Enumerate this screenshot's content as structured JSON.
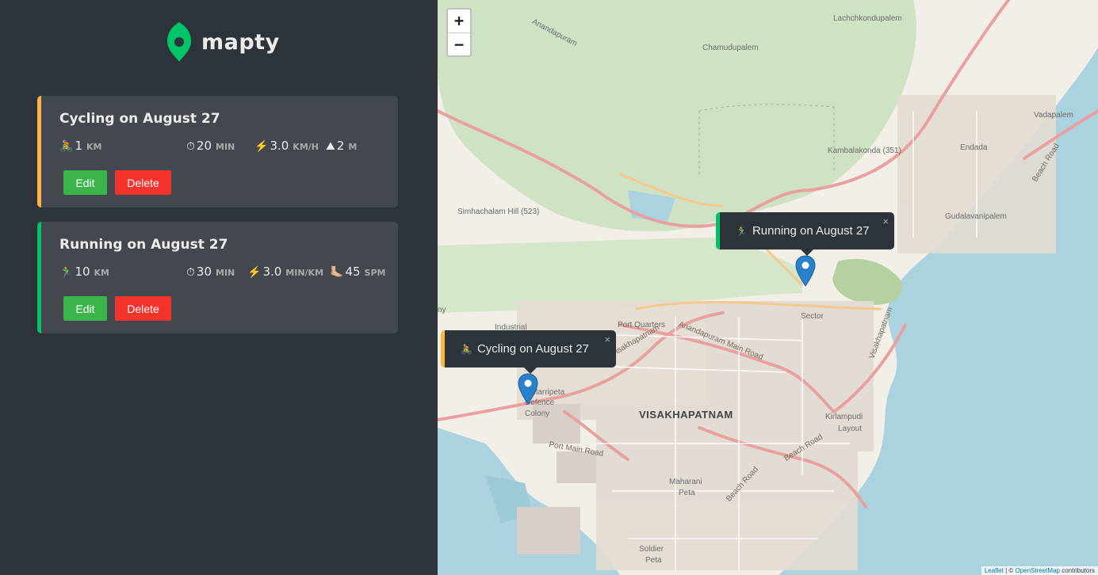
{
  "logo": {
    "text": "mapty",
    "icon": "map-pin-icon",
    "color": "#00c46a"
  },
  "workouts": [
    {
      "type": "cycling",
      "accent": "#ffb545",
      "title": "Cycling on August 27",
      "distance": {
        "icon": "🚴",
        "value": "1",
        "unit": "km"
      },
      "duration": {
        "icon": "⏱",
        "value": "20",
        "unit": "min"
      },
      "speed": {
        "icon": "⚡️",
        "value": "3.0",
        "unit": "km/h"
      },
      "extra": {
        "icon": "⛰",
        "value": "2",
        "unit": "m"
      },
      "edit_label": "Edit",
      "delete_label": "Delete"
    },
    {
      "type": "running",
      "accent": "#00c46a",
      "title": "Running on August 27",
      "distance": {
        "icon": "🏃‍♂️",
        "value": "10",
        "unit": "km"
      },
      "duration": {
        "icon": "⏱",
        "value": "30",
        "unit": "min"
      },
      "speed": {
        "icon": "⚡️",
        "value": "3.0",
        "unit": "min/km"
      },
      "extra": {
        "icon": "🦶🏼",
        "value": "45",
        "unit": "spm"
      },
      "edit_label": "Edit",
      "delete_label": "Delete"
    }
  ],
  "map": {
    "zoom_in": "+",
    "zoom_out": "−",
    "popups": {
      "running": {
        "icon": "🏃‍♂️",
        "text": "Running on August 27",
        "close": "×"
      },
      "cycling": {
        "icon": "🚴",
        "text": "Cycling on August 27",
        "close": "×"
      }
    },
    "labels": {
      "city": "VISAKHAPATNAM",
      "lachchkondupalem": "Lachchkondupalem",
      "anandapuram": "Anandapuram",
      "chamudupalem": "Chamudupalem",
      "vadapalem": "Vadapalem",
      "kambalakonda": "Kambalakonda (351)",
      "endada": "Endada",
      "simhachalam": "Simhachalam Hill (523)",
      "gudalavanipalem": "Gudalavanipalem",
      "beach_road_1": "Beach Road",
      "beach_road_2": "Beach Road",
      "beach_road_3": "Beach Road",
      "sector": "Sector",
      "port_quarters": "Port Quarters",
      "industrial": "Industrial",
      "anandapuram_main_road": "Anandapuram Main Road",
      "visakhapatnam_road": "Visakhapatnam",
      "visakhapatnam_road_2": "Visakhapatnam",
      "marripeta": "Marripeta",
      "defence_colony_1": "Defence",
      "defence_colony_2": "Colony",
      "port_main_road": "Port Main Road",
      "kirlampudi_1": "Kirlampudi",
      "kirlampudi_2": "Layout",
      "maharani_1": "Maharani",
      "maharani_2": "Peta",
      "soldier_1": "Soldier",
      "soldier_2": "Peta",
      "ny": "ny"
    },
    "attribution": {
      "leaflet": "Leaflet",
      "sep": " | © ",
      "osm": "OpenStreetMap",
      "rest": " contributors"
    }
  }
}
